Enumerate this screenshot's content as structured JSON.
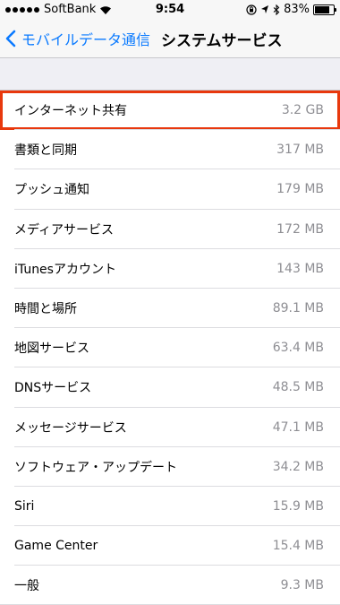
{
  "status_bar": {
    "carrier": "SoftBank",
    "time": "9:54",
    "battery_percent": "83%",
    "battery_level": 0.83,
    "icons": [
      "signal-dots",
      "wifi-icon",
      "orientation-lock-icon",
      "location-icon",
      "bluetooth-icon",
      "battery-icon"
    ]
  },
  "nav": {
    "back_label": "モバイルデータ通信",
    "title": "システムサービス"
  },
  "colors": {
    "accent": "#0a7aff",
    "highlight": "#e8380d",
    "secondary_text": "#8e8e93",
    "background": "#efeff4"
  },
  "services": [
    {
      "label": "インターネット共有",
      "value": "3.2 GB",
      "highlighted": true
    },
    {
      "label": "書類と同期",
      "value": "317 MB"
    },
    {
      "label": "プッシュ通知",
      "value": "179 MB"
    },
    {
      "label": "メディアサービス",
      "value": "172 MB"
    },
    {
      "label": "iTunesアカウント",
      "value": "143 MB"
    },
    {
      "label": "時間と場所",
      "value": "89.1 MB"
    },
    {
      "label": "地図サービス",
      "value": "63.4 MB"
    },
    {
      "label": "DNSサービス",
      "value": "48.5 MB"
    },
    {
      "label": "メッセージサービス",
      "value": "47.1 MB"
    },
    {
      "label": "ソフトウェア・アップデート",
      "value": "34.2 MB"
    },
    {
      "label": "Siri",
      "value": "15.9 MB"
    },
    {
      "label": "Game Center",
      "value": "15.4 MB"
    },
    {
      "label": "一般",
      "value": "9.3 MB"
    }
  ]
}
